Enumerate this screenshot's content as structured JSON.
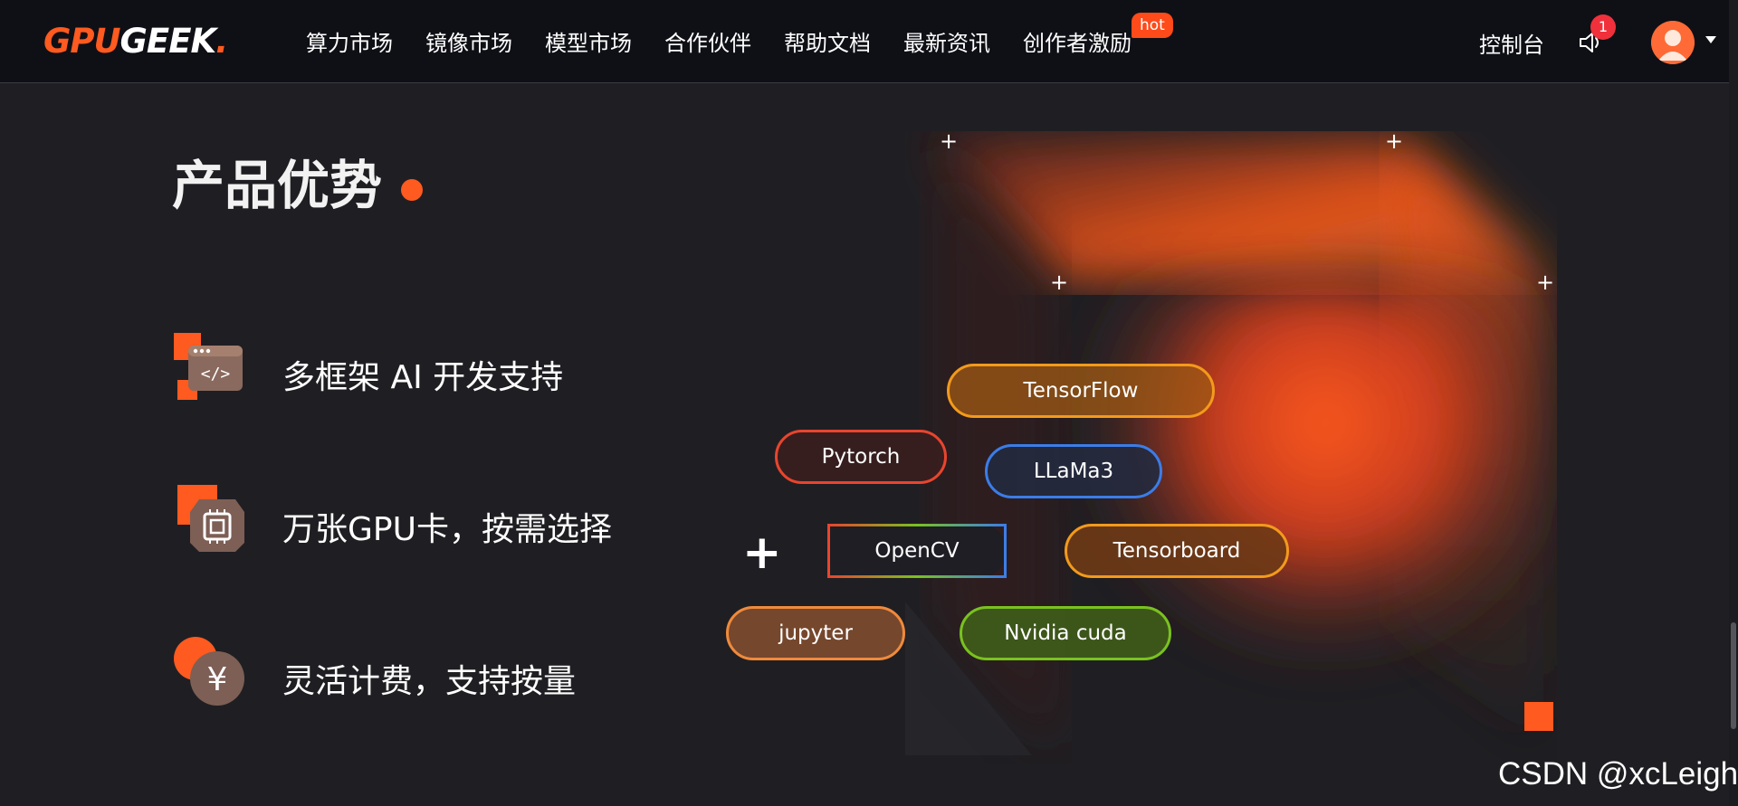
{
  "header": {
    "logo": {
      "part1": "GPU",
      "part2": "GEEK",
      "dot": "."
    },
    "nav": [
      {
        "label": "算力市场"
      },
      {
        "label": "镜像市场"
      },
      {
        "label": "模型市场"
      },
      {
        "label": "合作伙伴"
      },
      {
        "label": "帮助文档"
      },
      {
        "label": "最新资讯"
      },
      {
        "label": "创作者激励"
      }
    ],
    "hot_badge": "hot",
    "console_label": "控制台",
    "notification_count": "1",
    "icons": {
      "notification": "speaker-icon",
      "avatar": "user-avatar-icon",
      "dropdown": "caret-down-icon"
    }
  },
  "section": {
    "title": "产品优势",
    "features": [
      {
        "label": "多框架 AI 开发支持",
        "icon": "code-window-icon"
      },
      {
        "label": "万张GPU卡，按需选择",
        "icon": "chip-icon"
      },
      {
        "label": "灵活计费，支持按量",
        "icon": "yen-coin-icon"
      }
    ]
  },
  "frameworks": [
    {
      "label": "TensorFlow",
      "border": "#f39a1c",
      "fill": "#8a4a14"
    },
    {
      "label": "Pytorch",
      "border": "#e8452e",
      "fill": "#3a1e1e"
    },
    {
      "label": "LLaMa3",
      "border": "#3b7de8",
      "fill": "#242a3e"
    },
    {
      "label": "OpenCV",
      "border": "gradient",
      "fill": "#1e1e24"
    },
    {
      "label": "Tensorboard",
      "border": "#f39a1c",
      "fill": "#6b3a16"
    },
    {
      "label": "jupyter",
      "border": "#f08a3c",
      "fill": "#7a4a2e"
    },
    {
      "label": "Nvidia cuda",
      "border": "#7ac21f",
      "fill": "#3e5a1a"
    }
  ],
  "colors": {
    "accent": "#ff5a1f",
    "background": "#1f1f23",
    "header_bg": "#0f1016"
  },
  "watermark": "CSDN @xcLeigh"
}
